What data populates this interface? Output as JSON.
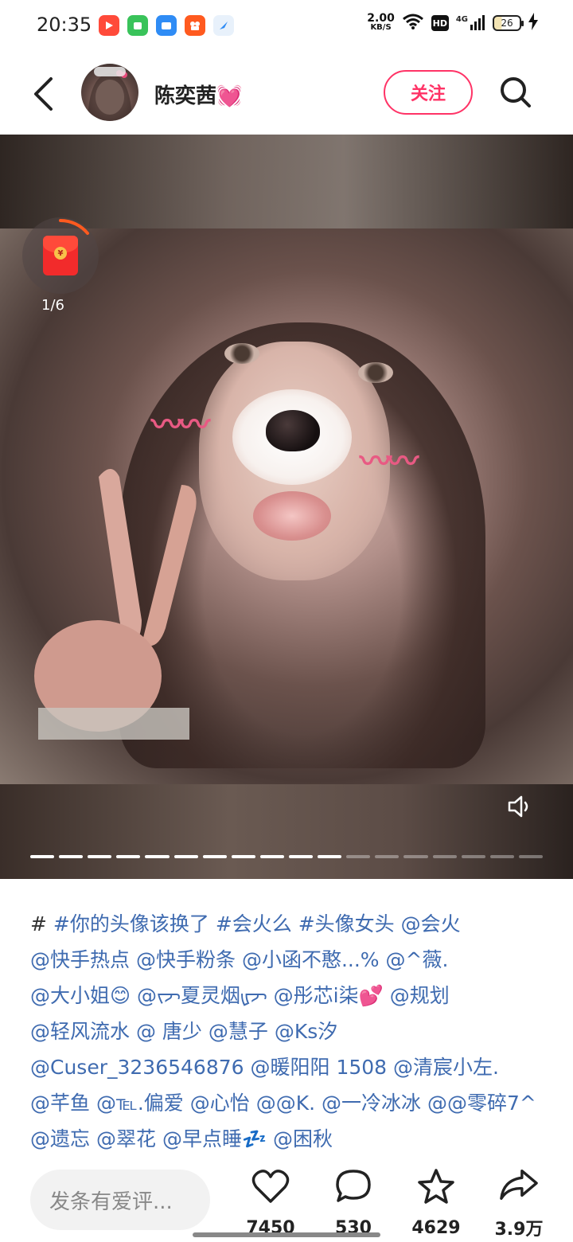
{
  "status_bar": {
    "time": "20:35",
    "net_speed_value": "2.00",
    "net_speed_unit": "KB/S",
    "hd_label": "HD",
    "signal_label": "4G",
    "battery_level": "26"
  },
  "header": {
    "username": "陈奕茜💓",
    "follow_label": "关注"
  },
  "media": {
    "red_packet_coin": "¥",
    "red_packet_count": "1/6",
    "total_pages": 18,
    "current_page": 11
  },
  "caption": {
    "lead": "#",
    "tags": [
      "#你的头像该换了",
      "#会火么",
      "#头像女头",
      "@会火",
      "@快手热点",
      "@快手粉条",
      "@小函不憨...%",
      "@^薇.",
      "@大小姐😊",
      "@ᡕᠵ夏灵烟ᡁᠵ",
      "@彤芯i柒💕",
      "@规划",
      "@轻风流水",
      "@ 唐少",
      "@慧子",
      "@Ks汐",
      "@Cuser_3236546876",
      "@暖阳阳 1508",
      "@清宸小左.",
      "@芊鱼",
      "@℡.偏爱",
      "@心怡",
      "@@K.",
      "@一冷冰冰",
      "@@零碎7^",
      "@遗忘",
      "@翠花",
      "@早点睡💤",
      "@困秋"
    ]
  },
  "bottom_bar": {
    "comment_placeholder": "发条有爱评...",
    "like_count": "7450",
    "comment_count": "530",
    "favorite_count": "4629",
    "share_count": "3.9万"
  },
  "colors": {
    "accent": "#ff3366",
    "link": "#3f6bb0"
  }
}
